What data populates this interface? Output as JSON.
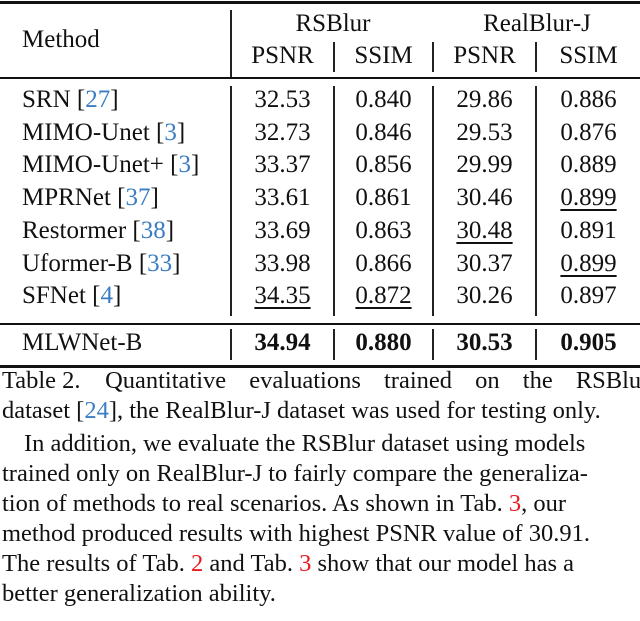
{
  "table": {
    "header": {
      "method_label": "Method",
      "groups": [
        {
          "name": "RSBlur",
          "metrics": [
            "PSNR",
            "SSIM"
          ]
        },
        {
          "name": "RealBlur-J",
          "metrics": [
            "PSNR",
            "SSIM"
          ]
        }
      ]
    },
    "rows": [
      {
        "method": "SRN",
        "cite": "27",
        "values": [
          "32.53",
          "0.840",
          "29.86",
          "0.886"
        ],
        "underline": [
          false,
          false,
          false,
          false
        ],
        "bold": false
      },
      {
        "method": "MIMO-Unet",
        "cite": "3",
        "values": [
          "32.73",
          "0.846",
          "29.53",
          "0.876"
        ],
        "underline": [
          false,
          false,
          false,
          false
        ],
        "bold": false
      },
      {
        "method": "MIMO-Unet+",
        "cite": "3",
        "values": [
          "33.37",
          "0.856",
          "29.99",
          "0.889"
        ],
        "underline": [
          false,
          false,
          false,
          false
        ],
        "bold": false
      },
      {
        "method": "MPRNet",
        "cite": "37",
        "values": [
          "33.61",
          "0.861",
          "30.46",
          "0.899"
        ],
        "underline": [
          false,
          false,
          false,
          true
        ],
        "bold": false
      },
      {
        "method": "Restormer",
        "cite": "38",
        "values": [
          "33.69",
          "0.863",
          "30.48",
          "0.891"
        ],
        "underline": [
          false,
          false,
          true,
          false
        ],
        "bold": false
      },
      {
        "method": "Uformer-B",
        "cite": "33",
        "values": [
          "33.98",
          "0.866",
          "30.37",
          "0.899"
        ],
        "underline": [
          false,
          false,
          false,
          true
        ],
        "bold": false
      },
      {
        "method": "SFNet",
        "cite": "4",
        "values": [
          "34.35",
          "0.872",
          "30.26",
          "0.897"
        ],
        "underline": [
          true,
          true,
          false,
          false
        ],
        "bold": false
      }
    ],
    "ours": {
      "method": "MLWNet-B",
      "values": [
        "34.94",
        "0.880",
        "30.53",
        "0.905"
      ],
      "bold": true
    }
  },
  "caption": {
    "label": "Table 2.",
    "line1_text": "Quantitative evaluations trained on the RSBlur",
    "line2_pre": "dataset [",
    "line2_cite": "24",
    "line2_post": "], the RealBlur-J dataset was used for testing only."
  },
  "paragraph": {
    "line1": "In addition, we evaluate the RSBlur dataset using models",
    "line2": "trained only on RealBlur-J to fairly compare the generaliza-",
    "line3_pre": "tion of methods to real scenarios.  As shown in Tab. ",
    "line3_ref": "3",
    "line3_post": ", our",
    "line4": "method produced results with highest PSNR value of 30.91.",
    "line5_pre": "The results of Tab. ",
    "line5_ref1": "2",
    "line5_mid": " and Tab. ",
    "line5_ref2": "3",
    "line5_post": " show that our model has a",
    "line6": "better generalization ability."
  },
  "colors": {
    "citation": "#3b7dc4",
    "cross_reference": "#e8191f",
    "text": "#111111"
  }
}
